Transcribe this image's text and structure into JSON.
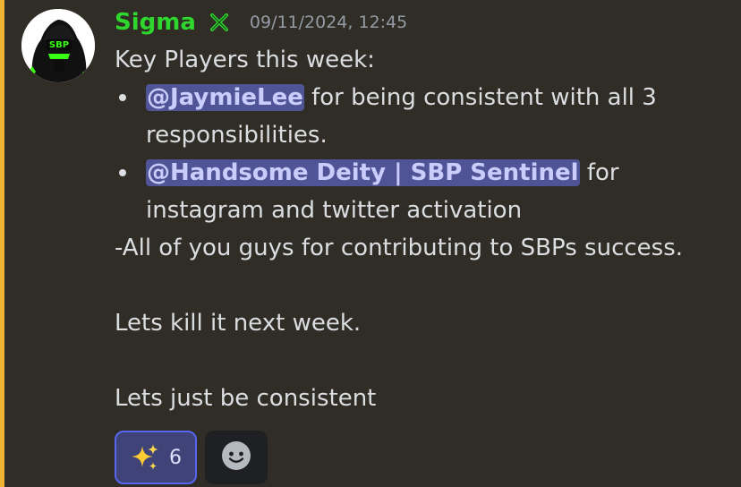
{
  "message": {
    "author": "Sigma",
    "timestamp": "09/11/2024, 12:45",
    "role_icon": "green-x-badge-icon",
    "avatar": "sbp-hooded-figure-avatar",
    "lines": {
      "intro": "Key Players this week:",
      "bullet1_mention": "@JaymieLee",
      "bullet1_text_a": " for being consistent with all 3",
      "bullet1_text_b": "responsibilities.",
      "bullet2_mention": "@Handsome Deity | SBP Sentinel",
      "bullet2_text_a": " for",
      "bullet2_text_b": "instagram and twitter activation",
      "contrib": "-All of you guys for contributing to SBPs success.",
      "kill": "Lets kill it next week.",
      "consistent": "Lets just be consistent"
    }
  },
  "reactions": [
    {
      "emoji": "sparkles-icon",
      "count": "6",
      "active": true
    }
  ],
  "add_reaction_icon": "smiley-add-reaction-icon",
  "colors": {
    "background": "#302d27",
    "mention_highlight": "#f0b232",
    "username": "#2ed62e",
    "mention_bg": "#4f5496",
    "mention_text": "#c9cdfb",
    "reaction_active_bg": "#3f4378",
    "reaction_active_border": "#5865f2"
  }
}
